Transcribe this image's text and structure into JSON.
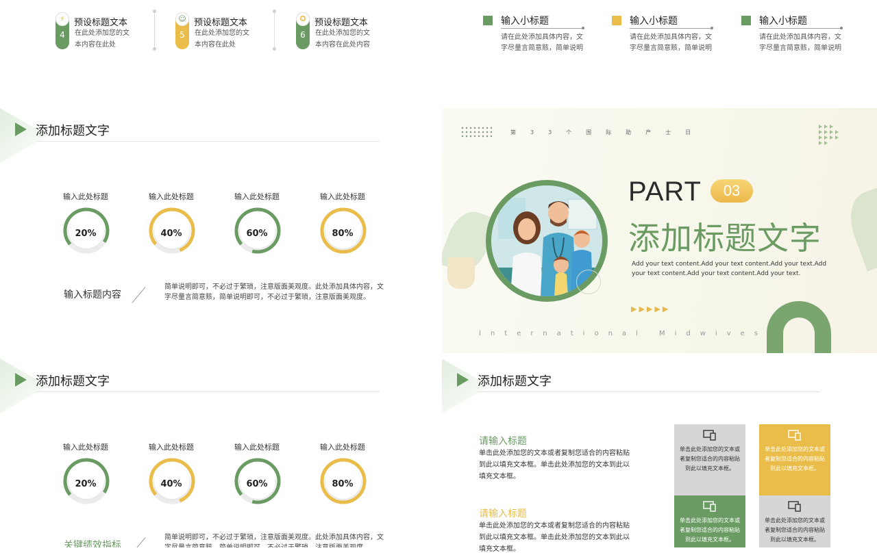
{
  "top": {
    "steps": [
      {
        "num": "4",
        "title": "预设标题文本",
        "desc": "在此处添加您的文本内容在此处",
        "color": "#6a9b63",
        "icon": "lightning-icon"
      },
      {
        "num": "5",
        "title": "预设标题文本",
        "desc": "在此处添加您的文本内容在此处",
        "color": "#eabd4a",
        "icon": "people-icon"
      },
      {
        "num": "6",
        "title": "预设标题文本",
        "desc": "在此处添加您的文本内容在此处内容",
        "color": "#6a9b63",
        "icon": "award-icon"
      }
    ],
    "subs": [
      {
        "title": "输入小标题",
        "desc": "请在此处添加具体内容，文字尽量言简意赅，简单说明",
        "color": "#6a9b63"
      },
      {
        "title": "输入小标题",
        "desc": "请在此处添加具体内容，文字尽量言简意赅，简单说明",
        "color": "#eabd4a"
      },
      {
        "title": "输入小标题",
        "desc": "请在此处添加具体内容，文字尽量言简意赅，简单说明",
        "color": "#6a9b63"
      }
    ]
  },
  "slide_a": {
    "title": "添加标题文字",
    "gauges": [
      {
        "label": "输入此处标题",
        "value": 20,
        "text": "20%",
        "color": "#6a9b63"
      },
      {
        "label": "输入此处标题",
        "value": 40,
        "text": "40%",
        "color": "#eabd4a"
      },
      {
        "label": "输入此处标题",
        "value": 60,
        "text": "60%",
        "color": "#6a9b63"
      },
      {
        "label": "输入此处标题",
        "value": 80,
        "text": "80%",
        "color": "#eabd4a"
      }
    ],
    "kpi": "输入标题内容",
    "desc": "简单说明即可，不必过于繁琐，注意版面美观度。此处添加具体内容，文字尽量言简意赅，简单说明即可，不必过于繁琐，注意版面美观度。"
  },
  "slide_b": {
    "title": "添加标题文字",
    "gauges": [
      {
        "label": "输入此处标题",
        "value": 20,
        "text": "20%",
        "color": "#6a9b63"
      },
      {
        "label": "输入此处标题",
        "value": 40,
        "text": "40%",
        "color": "#eabd4a"
      },
      {
        "label": "输入此处标题",
        "value": 60,
        "text": "60%",
        "color": "#6a9b63"
      },
      {
        "label": "输入此处标题",
        "value": 80,
        "text": "80%",
        "color": "#eabd4a"
      }
    ],
    "kpi": "关键绩效指标",
    "desc": "简单说明即可，不必过于繁琐，注意版面美观度。此处添加具体内容，文字尽量言简意赅，简单说明即可，不必过于繁琐，注意版面美观度。"
  },
  "part": {
    "top_text": "第33个国际助产士日",
    "part": "PART",
    "number": "03",
    "title": "添加标题文字",
    "desc": "Add your text content.Add your text content.Add your text.Add your text content.Add your text content.Add your text.",
    "arrows": "▶▶▶▶▶",
    "bottom_text": "International Midwives"
  },
  "slide_c": {
    "title": "添加标题文字",
    "prompts": [
      {
        "title": "请输入标题",
        "text": "单击此处添加您的文本或者复制您适合的内容粘贴到此以填充文本框。单击此处添加您的文本到此以填充文本框。",
        "color": "#6a9b63"
      },
      {
        "title": "请输入标题",
        "text": "单击此处添加您的文本或者复制您适合的内容粘贴到此以填充文本框。单击此处添加您的文本到此以填充文本框。",
        "color": "#eabd4a"
      }
    ],
    "cards": [
      {
        "text": "单击此处添加您的文本或者复制您适合的内容粘贴到此以填充文本框。",
        "bg": "#d6d6d6",
        "fg": "#333333"
      },
      {
        "text": "单击此处添加您的文本或者复制您适合的内容粘贴到此以填充文本框。",
        "bg": "#eabd4a",
        "fg": "#ffffff"
      },
      {
        "text": "单击此处添加您的文本或者复制您适合的内容粘贴到此以填充文本框。",
        "bg": "#6a9b63",
        "fg": "#ffffff"
      },
      {
        "text": "单击此处添加您的文本或者复制您适合的内容粘贴到此以填充文本框。",
        "bg": "#d6d6d6",
        "fg": "#333333"
      }
    ]
  }
}
